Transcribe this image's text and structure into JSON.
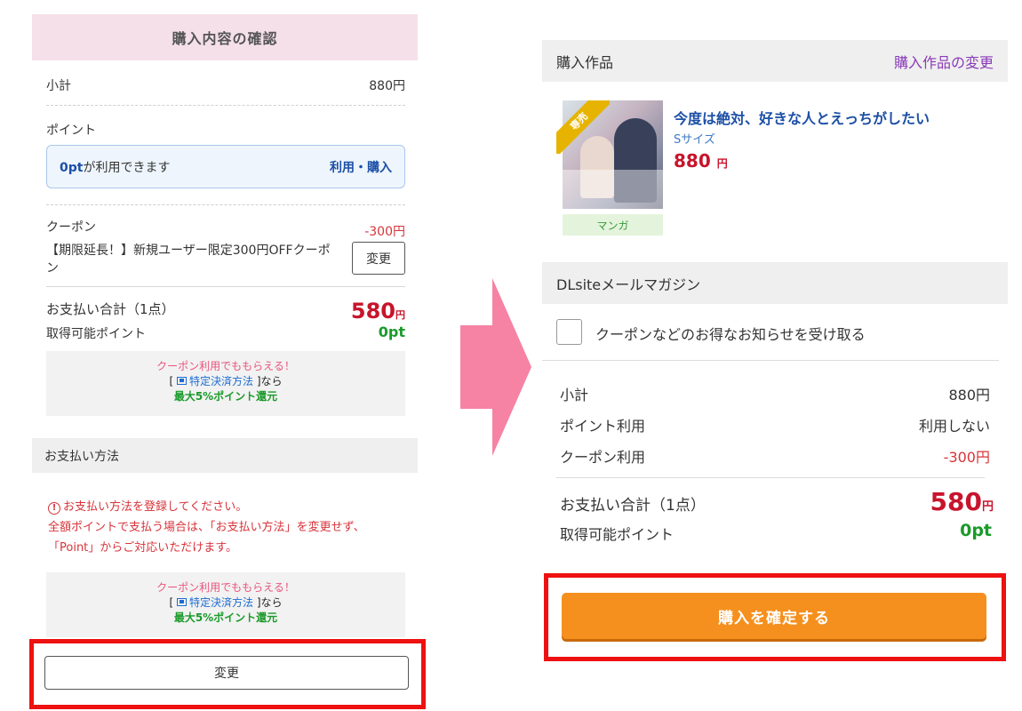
{
  "left": {
    "header": "購入内容の確認",
    "subtotal": {
      "label": "小計",
      "value": "880円"
    },
    "points": {
      "label": "ポイント",
      "box_prefix": "0pt",
      "box_text": "が利用できます",
      "link": "利用・購入"
    },
    "coupon": {
      "label": "クーポン",
      "value": "-300円",
      "description": "【期限延長！】新規ユーザー限定300円OFFクーポン",
      "change_button": "変更"
    },
    "total": {
      "label": "お支払い合計（1点）",
      "value": "580",
      "unit": "円"
    },
    "earn_points": {
      "label": "取得可能ポイント",
      "value": "0pt"
    },
    "promo": {
      "line1": "クーポン利用でももらえる！",
      "bracket_open": "[",
      "link": "特定決済方法",
      "bracket_close": "]なら",
      "line3": "最大5%ポイント還元"
    },
    "payment_header": "お支払い方法",
    "warning": {
      "icon": "!",
      "line1": "お支払い方法を登録してください。",
      "line2": "全額ポイントで支払う場合は、「お支払い方法」を変更せず、「Point」からご対応いただけます。"
    },
    "change_button": "変更"
  },
  "right": {
    "header": {
      "title": "購入作品",
      "link": "購入作品の変更"
    },
    "product": {
      "badge": "専売",
      "title": "今度は絶対、好きな人とえっちがしたい",
      "size": "Sサイズ",
      "price": "880",
      "price_unit": "円",
      "category": "マンガ"
    },
    "magazine": {
      "header": "DLsiteメールマガジン",
      "checkbox_label": "クーポンなどのお得なお知らせを受け取る"
    },
    "summary": [
      {
        "label": "小計",
        "value": "880円"
      },
      {
        "label": "ポイント利用",
        "value": "利用しない"
      },
      {
        "label": "クーポン利用",
        "value": "-300円"
      }
    ],
    "total": {
      "label": "お支払い合計（1点）",
      "value": "580",
      "unit": "円"
    },
    "earn_points": {
      "label": "取得可能ポイント",
      "value": "0pt"
    },
    "confirm_button": "購入を確定する"
  },
  "colors": {
    "accent_orange": "#f5901e",
    "price_red": "#c8142c",
    "highlight_red": "#ee1111",
    "arrow_pink": "#f682a4",
    "link_blue": "#1c4fa6",
    "point_green": "#1a9a2a"
  }
}
